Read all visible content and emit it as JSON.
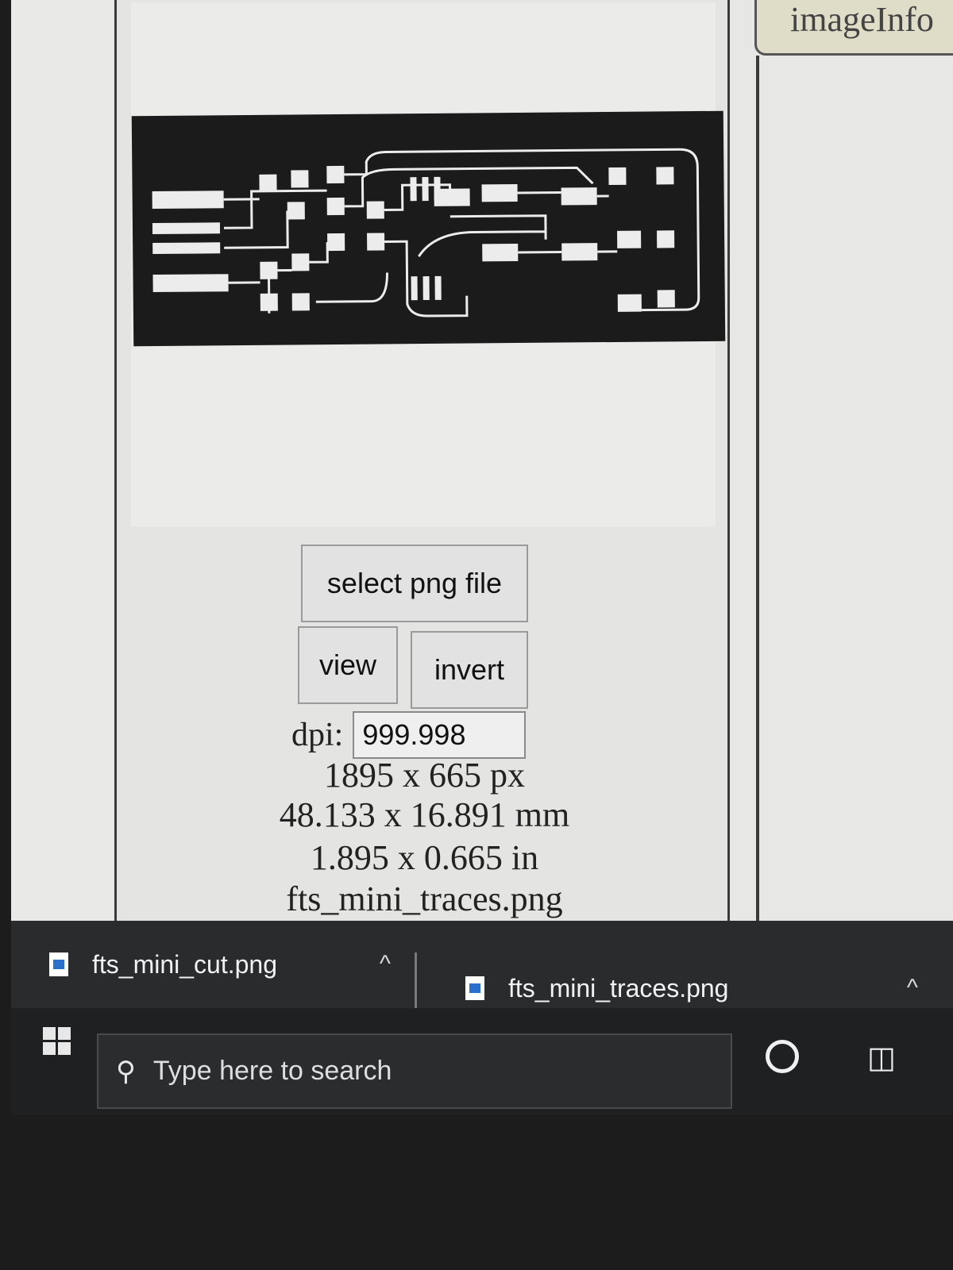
{
  "app": {
    "right_panel_label": "imageInfo"
  },
  "controls": {
    "select_label": "select png file",
    "view_label": "view",
    "invert_label": "invert",
    "dpi_label": "dpi:",
    "dpi_value": "999.998"
  },
  "image_info": {
    "pixels": "1895 x 665 px",
    "mm": "48.133 x 16.891 mm",
    "inches": "1.895 x 0.665 in",
    "filename": "fts_mini_traces.png"
  },
  "downloads": {
    "items": [
      {
        "name": "fts_mini_cut.png",
        "icon": "file-image-icon"
      },
      {
        "name": "fts_mini_traces.png",
        "icon": "file-image-icon"
      }
    ]
  },
  "taskbar": {
    "search_placeholder": "Type here to search"
  },
  "colors": {
    "pcb_background": "#1b1b1b",
    "trace_color": "#ececec",
    "taskbar": "#1f2022"
  }
}
